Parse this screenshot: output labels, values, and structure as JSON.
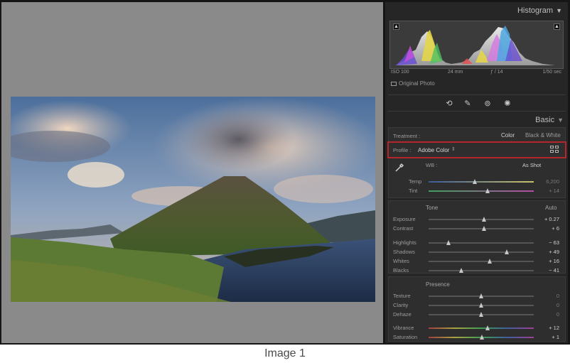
{
  "histogram": {
    "title": "Histogram",
    "iso": "ISO 100",
    "focal": "24 mm",
    "aperture": "ƒ / 14",
    "shutter": "1/50 sec",
    "original_photo_label": "Original Photo"
  },
  "tool_strip": {
    "icons": [
      "crop-icon",
      "healing-brush-icon",
      "red-eye-icon",
      "masking-icon"
    ]
  },
  "basic": {
    "title": "Basic",
    "treatment": {
      "label": "Treatment :",
      "color": "Color",
      "bw": "Black & White"
    },
    "profile": {
      "label": "Profile :",
      "value": "Adobe Color"
    },
    "wb": {
      "label": "WB :",
      "value": "As Shot"
    },
    "temp": {
      "label": "Temp",
      "value": "6,200",
      "position": 0.44
    },
    "tint": {
      "label": "Tint",
      "value": "+ 14",
      "position": 0.56
    },
    "tone": {
      "title": "Tone",
      "auto": "Auto",
      "sliders": [
        {
          "label": "Exposure",
          "value": "+ 0.27",
          "position": 0.53
        },
        {
          "label": "Contrast",
          "value": "+ 6",
          "position": 0.53
        },
        {
          "label": "Highlights",
          "value": "− 63",
          "position": 0.19
        },
        {
          "label": "Shadows",
          "value": "+ 49",
          "position": 0.74
        },
        {
          "label": "Whites",
          "value": "+ 16",
          "position": 0.58
        },
        {
          "label": "Blacks",
          "value": "− 41",
          "position": 0.31
        }
      ]
    },
    "presence": {
      "title": "Presence",
      "sliders": [
        {
          "label": "Texture",
          "value": "0",
          "position": 0.5
        },
        {
          "label": "Clarity",
          "value": "0",
          "position": 0.5
        },
        {
          "label": "Dehaze",
          "value": "0",
          "position": 0.5
        },
        {
          "label": "Vibrance",
          "value": "+ 12",
          "position": 0.56
        },
        {
          "label": "Saturation",
          "value": "+ 1",
          "position": 0.51
        }
      ]
    }
  },
  "caption": "Image 1"
}
